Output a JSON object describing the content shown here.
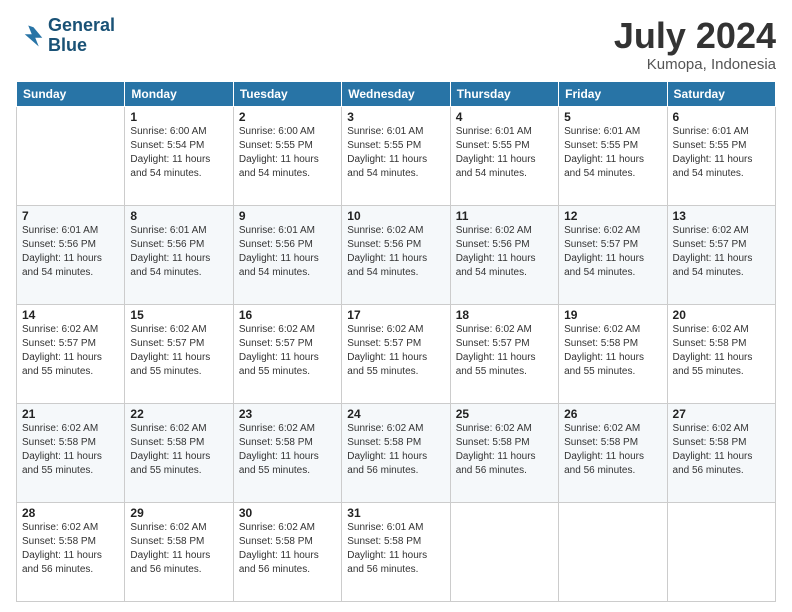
{
  "logo": {
    "line1": "General",
    "line2": "Blue"
  },
  "title": "July 2024",
  "location": "Kumopa, Indonesia",
  "days_header": [
    "Sunday",
    "Monday",
    "Tuesday",
    "Wednesday",
    "Thursday",
    "Friday",
    "Saturday"
  ],
  "weeks": [
    [
      {
        "day": "",
        "sunrise": "",
        "sunset": "",
        "daylight": ""
      },
      {
        "day": "1",
        "sunrise": "Sunrise: 6:00 AM",
        "sunset": "Sunset: 5:54 PM",
        "daylight": "Daylight: 11 hours and 54 minutes."
      },
      {
        "day": "2",
        "sunrise": "Sunrise: 6:00 AM",
        "sunset": "Sunset: 5:55 PM",
        "daylight": "Daylight: 11 hours and 54 minutes."
      },
      {
        "day": "3",
        "sunrise": "Sunrise: 6:01 AM",
        "sunset": "Sunset: 5:55 PM",
        "daylight": "Daylight: 11 hours and 54 minutes."
      },
      {
        "day": "4",
        "sunrise": "Sunrise: 6:01 AM",
        "sunset": "Sunset: 5:55 PM",
        "daylight": "Daylight: 11 hours and 54 minutes."
      },
      {
        "day": "5",
        "sunrise": "Sunrise: 6:01 AM",
        "sunset": "Sunset: 5:55 PM",
        "daylight": "Daylight: 11 hours and 54 minutes."
      },
      {
        "day": "6",
        "sunrise": "Sunrise: 6:01 AM",
        "sunset": "Sunset: 5:55 PM",
        "daylight": "Daylight: 11 hours and 54 minutes."
      }
    ],
    [
      {
        "day": "7",
        "sunrise": "Sunrise: 6:01 AM",
        "sunset": "Sunset: 5:56 PM",
        "daylight": "Daylight: 11 hours and 54 minutes."
      },
      {
        "day": "8",
        "sunrise": "Sunrise: 6:01 AM",
        "sunset": "Sunset: 5:56 PM",
        "daylight": "Daylight: 11 hours and 54 minutes."
      },
      {
        "day": "9",
        "sunrise": "Sunrise: 6:01 AM",
        "sunset": "Sunset: 5:56 PM",
        "daylight": "Daylight: 11 hours and 54 minutes."
      },
      {
        "day": "10",
        "sunrise": "Sunrise: 6:02 AM",
        "sunset": "Sunset: 5:56 PM",
        "daylight": "Daylight: 11 hours and 54 minutes."
      },
      {
        "day": "11",
        "sunrise": "Sunrise: 6:02 AM",
        "sunset": "Sunset: 5:56 PM",
        "daylight": "Daylight: 11 hours and 54 minutes."
      },
      {
        "day": "12",
        "sunrise": "Sunrise: 6:02 AM",
        "sunset": "Sunset: 5:57 PM",
        "daylight": "Daylight: 11 hours and 54 minutes."
      },
      {
        "day": "13",
        "sunrise": "Sunrise: 6:02 AM",
        "sunset": "Sunset: 5:57 PM",
        "daylight": "Daylight: 11 hours and 54 minutes."
      }
    ],
    [
      {
        "day": "14",
        "sunrise": "Sunrise: 6:02 AM",
        "sunset": "Sunset: 5:57 PM",
        "daylight": "Daylight: 11 hours and 55 minutes."
      },
      {
        "day": "15",
        "sunrise": "Sunrise: 6:02 AM",
        "sunset": "Sunset: 5:57 PM",
        "daylight": "Daylight: 11 hours and 55 minutes."
      },
      {
        "day": "16",
        "sunrise": "Sunrise: 6:02 AM",
        "sunset": "Sunset: 5:57 PM",
        "daylight": "Daylight: 11 hours and 55 minutes."
      },
      {
        "day": "17",
        "sunrise": "Sunrise: 6:02 AM",
        "sunset": "Sunset: 5:57 PM",
        "daylight": "Daylight: 11 hours and 55 minutes."
      },
      {
        "day": "18",
        "sunrise": "Sunrise: 6:02 AM",
        "sunset": "Sunset: 5:57 PM",
        "daylight": "Daylight: 11 hours and 55 minutes."
      },
      {
        "day": "19",
        "sunrise": "Sunrise: 6:02 AM",
        "sunset": "Sunset: 5:58 PM",
        "daylight": "Daylight: 11 hours and 55 minutes."
      },
      {
        "day": "20",
        "sunrise": "Sunrise: 6:02 AM",
        "sunset": "Sunset: 5:58 PM",
        "daylight": "Daylight: 11 hours and 55 minutes."
      }
    ],
    [
      {
        "day": "21",
        "sunrise": "Sunrise: 6:02 AM",
        "sunset": "Sunset: 5:58 PM",
        "daylight": "Daylight: 11 hours and 55 minutes."
      },
      {
        "day": "22",
        "sunrise": "Sunrise: 6:02 AM",
        "sunset": "Sunset: 5:58 PM",
        "daylight": "Daylight: 11 hours and 55 minutes."
      },
      {
        "day": "23",
        "sunrise": "Sunrise: 6:02 AM",
        "sunset": "Sunset: 5:58 PM",
        "daylight": "Daylight: 11 hours and 55 minutes."
      },
      {
        "day": "24",
        "sunrise": "Sunrise: 6:02 AM",
        "sunset": "Sunset: 5:58 PM",
        "daylight": "Daylight: 11 hours and 56 minutes."
      },
      {
        "day": "25",
        "sunrise": "Sunrise: 6:02 AM",
        "sunset": "Sunset: 5:58 PM",
        "daylight": "Daylight: 11 hours and 56 minutes."
      },
      {
        "day": "26",
        "sunrise": "Sunrise: 6:02 AM",
        "sunset": "Sunset: 5:58 PM",
        "daylight": "Daylight: 11 hours and 56 minutes."
      },
      {
        "day": "27",
        "sunrise": "Sunrise: 6:02 AM",
        "sunset": "Sunset: 5:58 PM",
        "daylight": "Daylight: 11 hours and 56 minutes."
      }
    ],
    [
      {
        "day": "28",
        "sunrise": "Sunrise: 6:02 AM",
        "sunset": "Sunset: 5:58 PM",
        "daylight": "Daylight: 11 hours and 56 minutes."
      },
      {
        "day": "29",
        "sunrise": "Sunrise: 6:02 AM",
        "sunset": "Sunset: 5:58 PM",
        "daylight": "Daylight: 11 hours and 56 minutes."
      },
      {
        "day": "30",
        "sunrise": "Sunrise: 6:02 AM",
        "sunset": "Sunset: 5:58 PM",
        "daylight": "Daylight: 11 hours and 56 minutes."
      },
      {
        "day": "31",
        "sunrise": "Sunrise: 6:01 AM",
        "sunset": "Sunset: 5:58 PM",
        "daylight": "Daylight: 11 hours and 56 minutes."
      },
      {
        "day": "",
        "sunrise": "",
        "sunset": "",
        "daylight": ""
      },
      {
        "day": "",
        "sunrise": "",
        "sunset": "",
        "daylight": ""
      },
      {
        "day": "",
        "sunrise": "",
        "sunset": "",
        "daylight": ""
      }
    ]
  ]
}
